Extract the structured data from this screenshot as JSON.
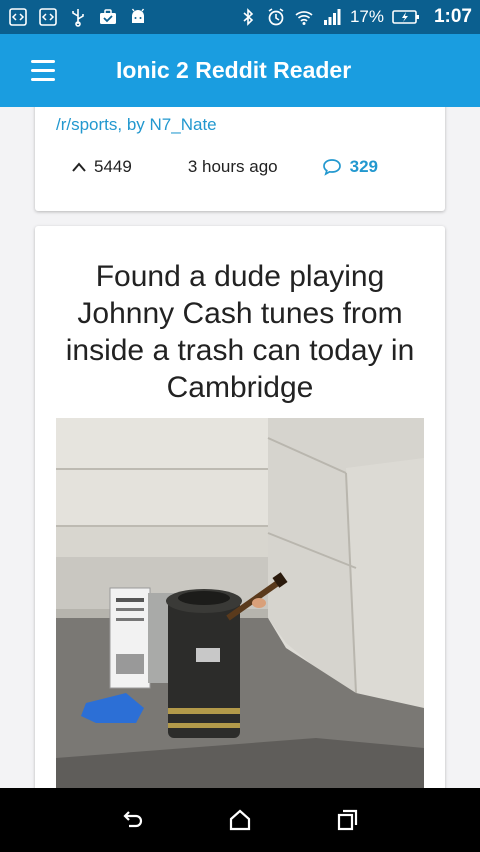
{
  "status_bar": {
    "battery": "17%",
    "time": "1:07"
  },
  "toolbar": {
    "title": "Ionic 2 Reddit Reader"
  },
  "posts": [
    {
      "source": "/r/sports, by N7_Nate",
      "score": "5449",
      "time_ago": "3 hours ago",
      "comments": "329"
    },
    {
      "title": "Found a dude playing Johnny Cash tunes from inside a trash can today in Cambridge"
    }
  ],
  "colors": {
    "toolbar": "#1a9de0",
    "status_bar": "#0b5f8f",
    "link": "#2298cf"
  }
}
